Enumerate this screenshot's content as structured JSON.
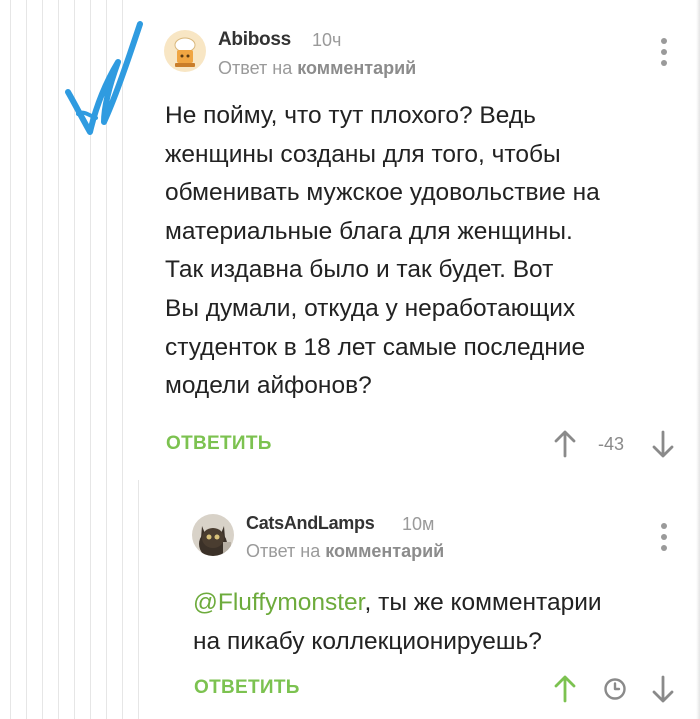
{
  "comments": [
    {
      "author": "Abiboss",
      "time": "10ч",
      "reply_prefix": "Ответ на",
      "reply_target": "комментарий",
      "text_lines": [
        "Не пойму, что тут плохого? Ведь",
        "женщины созданы для того, чтобы",
        "обменивать мужское удовольствие на",
        "материальные блага для женщины.",
        "Так издавна было и так будет. Вот",
        "Вы думали, откуда у неработающих",
        "студенток в 18 лет самые последние",
        "модели айфонов?"
      ],
      "reply_label": "ОТВЕТИТЬ",
      "rating": "-43",
      "icons": {
        "upvote": "arrow-up-icon",
        "downvote": "arrow-down-icon",
        "menu": "more-vertical-icon"
      }
    },
    {
      "author": "CatsAndLamps",
      "time": "10м",
      "reply_prefix": "Ответ на",
      "reply_target": "комментарий",
      "mention": "@Fluffymonster",
      "text_after_mention": ", ты же комментарии",
      "text_line2": "на пикабу коллекционируешь?",
      "reply_label": "ОТВЕТИТЬ",
      "icons": {
        "upvote": "arrow-up-icon",
        "pending": "clock-icon",
        "downvote": "arrow-down-icon",
        "menu": "more-vertical-icon"
      }
    }
  ],
  "colors": {
    "accent_green": "#7cc250",
    "mention_green": "#6dab3c",
    "checkmark_blue": "#2f9be0",
    "muted": "#9a9a9a"
  }
}
